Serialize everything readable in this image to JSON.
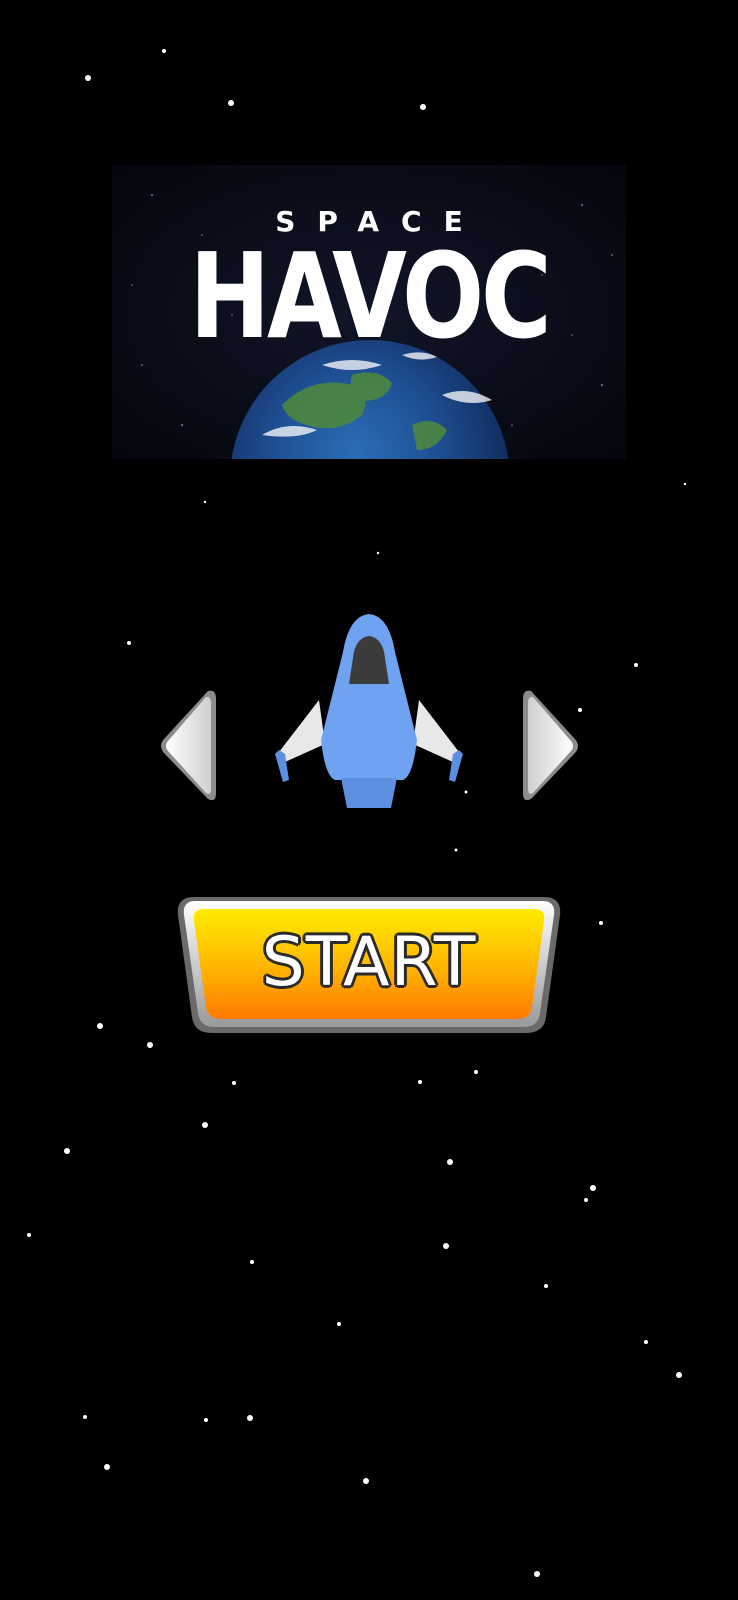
{
  "title": {
    "small": "SPACE",
    "big": "HAVOC"
  },
  "ship_selector": {
    "prev_icon": "chevron-left-icon",
    "next_icon": "chevron-right-icon",
    "ship_icon": "spaceship-icon"
  },
  "start_button": {
    "label": "START"
  },
  "colors": {
    "background": "#000000",
    "ship_body": "#6fa3f2",
    "ship_wing": "#e6e6e6",
    "ship_cockpit": "#3b3b3b",
    "start_top": "#ffe600",
    "start_bottom": "#ff7a00",
    "arrow": "#e9e9e9"
  }
}
